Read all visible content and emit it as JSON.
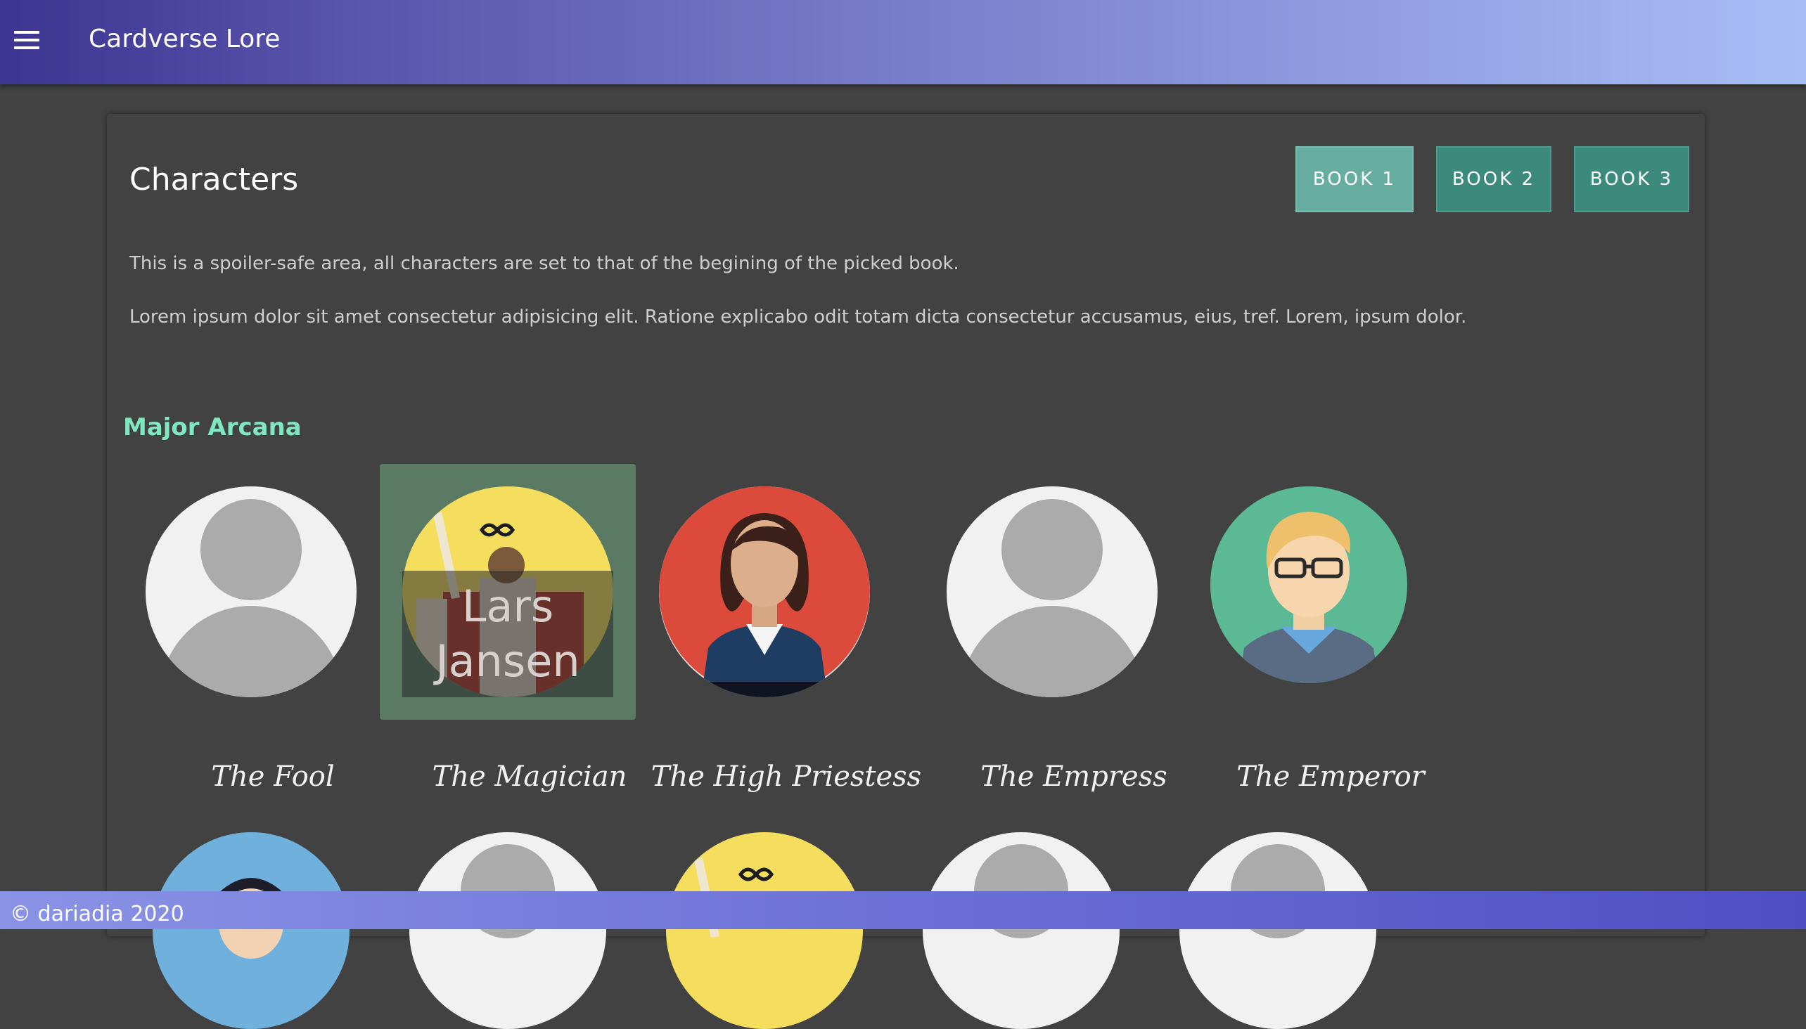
{
  "app": {
    "title": "Cardverse Lore",
    "menu_icon": "hamburger-menu-icon"
  },
  "page": {
    "title": "Characters",
    "books": [
      "BOOK 1",
      "BOOK 2",
      "BOOK 3"
    ],
    "active_book": "BOOK 1",
    "intro_1": "This is a spoiler-safe area, all characters are set to that of the begining of the picked book.",
    "intro_2": "Lorem ipsum dolor sit amet consectetur adipisicing elit. Ratione explicabo odit totam dicta consectetur accusamus, eius, tref. Lorem, ipsum dolor."
  },
  "group": {
    "title": "Major Arcana",
    "characters": [
      {
        "name": "The Fool",
        "avatar": "placeholder-person"
      },
      {
        "name": "The Magician",
        "avatar": "magician-tarot",
        "hover_label": "Lars Jansen"
      },
      {
        "name": "The High Priestess",
        "avatar": "woman-red"
      },
      {
        "name": "The Empress",
        "avatar": "placeholder-person"
      },
      {
        "name": "The Emperor",
        "avatar": "man-glasses-green"
      }
    ],
    "second_row_avatars": [
      "man-blue",
      "placeholder-person",
      "magician-tarot",
      "placeholder-person",
      "placeholder-person"
    ]
  },
  "colors": {
    "accent": "#7fe7c1",
    "book_button": "#3b8a7b",
    "book_button_active": "#67ada0"
  },
  "footer": {
    "text": "© dariadia 2020"
  }
}
